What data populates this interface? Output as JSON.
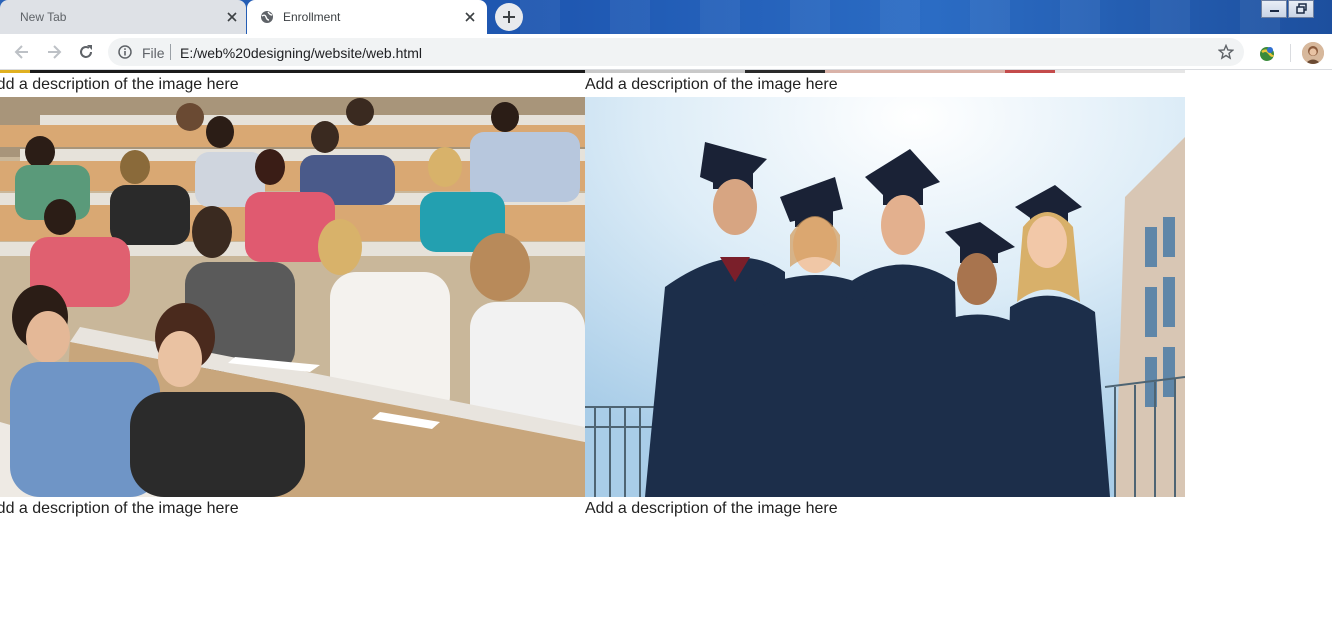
{
  "browser": {
    "tabs": [
      {
        "title": "New Tab",
        "active": false
      },
      {
        "title": "Enrollment",
        "active": true
      }
    ],
    "omnibox": {
      "scheme_label": "File",
      "url": "E:/web%20designing/website/web.html"
    }
  },
  "page": {
    "captions": {
      "top_left": "Add a description of the image here",
      "top_right": "Add a description of the image here",
      "bottom_left": "Add a description of the image here",
      "bottom_right": "Add a description of the image here"
    }
  },
  "colors": {
    "tabstrip": "#1e56b0",
    "inactive_tab": "#dee1e6",
    "active_tab": "#ffffff",
    "gown": "#1c2e4a"
  },
  "icons": [
    "globe-icon",
    "close-icon",
    "plus-icon",
    "back-arrow-icon",
    "forward-arrow-icon",
    "reload-icon",
    "info-icon",
    "star-icon",
    "extension-icon",
    "profile-avatar"
  ]
}
